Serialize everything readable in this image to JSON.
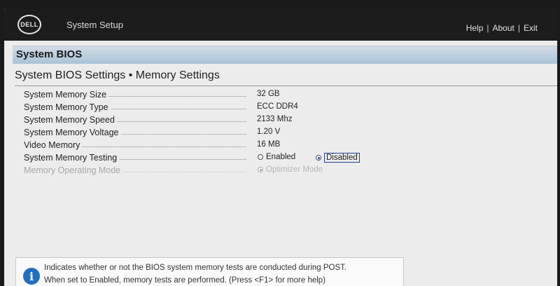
{
  "header": {
    "logo_text": "DELL",
    "app_title": "System Setup",
    "links": [
      "Help",
      "About",
      "Exit"
    ],
    "separator": "|"
  },
  "section": {
    "title": "System BIOS"
  },
  "page": {
    "heading": "System BIOS Settings • Memory Settings"
  },
  "settings": [
    {
      "label": "System Memory Size",
      "value": "32 GB"
    },
    {
      "label": "System Memory Type",
      "value": "ECC DDR4"
    },
    {
      "label": "System Memory Speed",
      "value": "2133 Mhz"
    },
    {
      "label": "System Memory Voltage",
      "value": "1.20 V"
    },
    {
      "label": "Video Memory",
      "value": "16 MB"
    },
    {
      "label": "System Memory Testing",
      "options": [
        "Enabled",
        "Disabled"
      ],
      "selected": "Disabled"
    },
    {
      "label": "Memory Operating Mode",
      "options": [
        "Optimizer Mode"
      ],
      "selected": "Optimizer Mode",
      "disabled": true
    }
  ],
  "help": {
    "icon": "info-icon",
    "line1": "Indicates whether or not the BIOS system memory tests are conducted during POST.",
    "line2": "When set to Enabled, memory tests are performed. (Press <F1> for more help)"
  },
  "colors": {
    "topbar": "#1c1c1c",
    "section_bar": "#a9c3d6",
    "accent": "#1f3f8f",
    "info": "#1f6fc0"
  }
}
